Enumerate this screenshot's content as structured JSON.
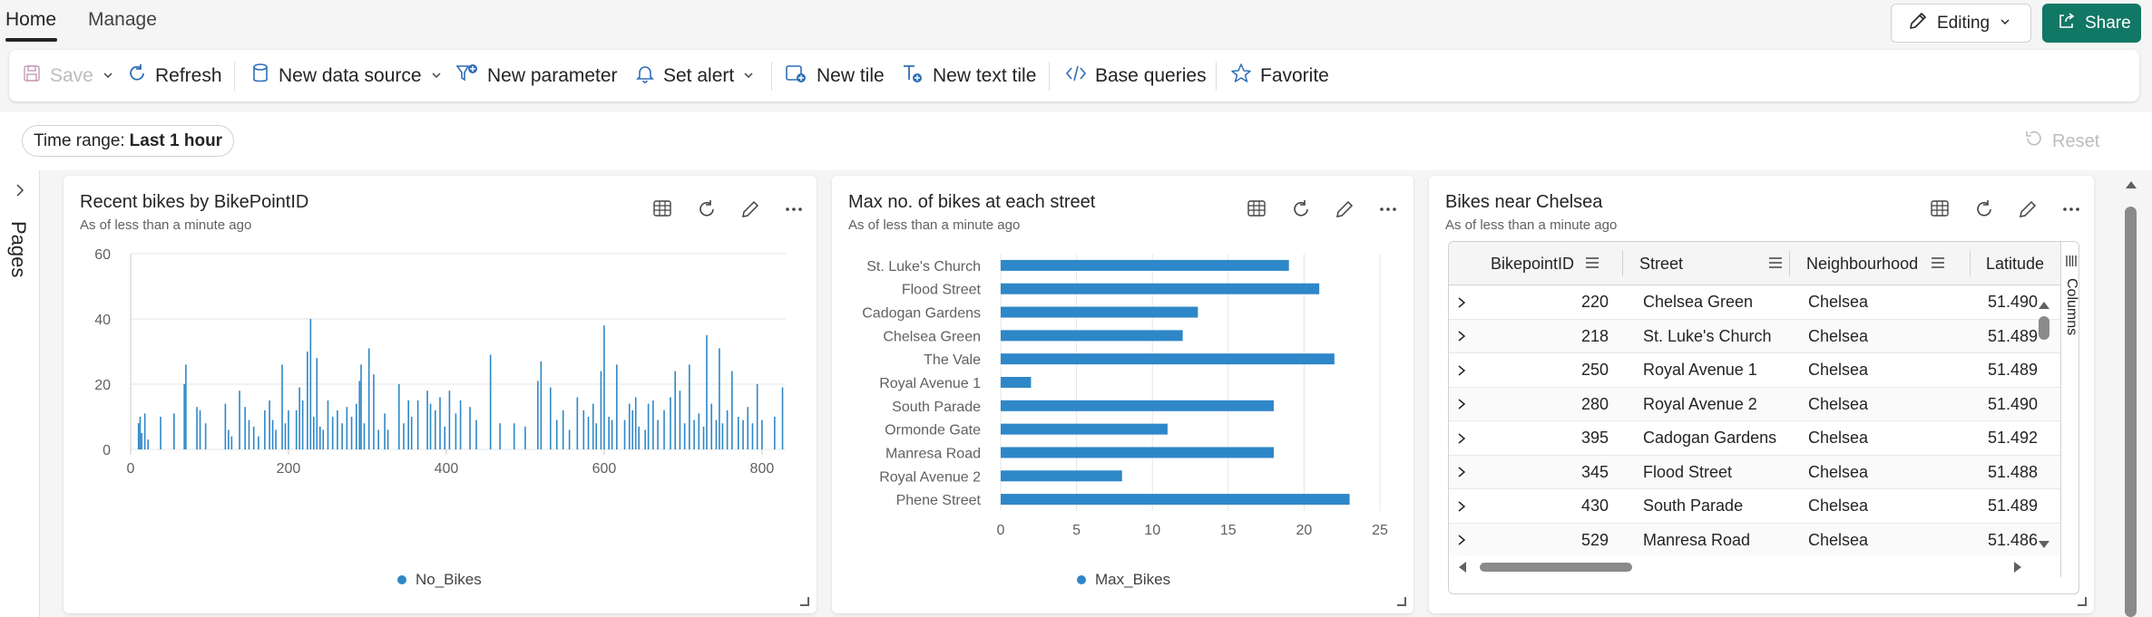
{
  "top_tabs": {
    "home": "Home",
    "manage": "Manage"
  },
  "header_buttons": {
    "editing": "Editing",
    "share": "Share"
  },
  "toolbar": {
    "save": "Save",
    "refresh": "Refresh",
    "new_data_source": "New data source",
    "new_parameter": "New parameter",
    "set_alert": "Set alert",
    "new_tile": "New tile",
    "new_text_tile": "New text tile",
    "base_queries": "Base queries",
    "favorite": "Favorite"
  },
  "filters": {
    "time_range_label": "Time range:",
    "time_range_value": "Last 1 hour",
    "reset": "Reset"
  },
  "pages_label": "Pages",
  "colors": {
    "accent": "#117865",
    "series": "#2e87c8"
  },
  "tiles": [
    {
      "title": "Recent bikes by BikePointID",
      "subtitle": "As of less than a minute ago",
      "legend": "No_Bikes"
    },
    {
      "title": "Max no. of bikes at each street",
      "subtitle": "As of less than a minute ago",
      "legend": "Max_Bikes"
    },
    {
      "title": "Bikes near Chelsea",
      "subtitle": "As of less than a minute ago"
    }
  ],
  "chart_data": [
    {
      "type": "bar",
      "title": "Recent bikes by BikePointID",
      "xlim": [
        0,
        830
      ],
      "ylim": [
        0,
        60
      ],
      "x_ticks": [
        "0",
        "200",
        "400",
        "600",
        "800"
      ],
      "y_ticks": [
        "0",
        "20",
        "40",
        "60"
      ],
      "grid": true,
      "legend_position": "bottom",
      "series": [
        {
          "name": "No_Bikes",
          "points": [
            [
              10,
              8
            ],
            [
              12,
              10
            ],
            [
              14,
              5
            ],
            [
              18,
              11
            ],
            [
              22,
              3
            ],
            [
              38,
              10
            ],
            [
              55,
              11
            ],
            [
              68,
              20
            ],
            [
              70,
              26
            ],
            [
              84,
              13
            ],
            [
              88,
              12
            ],
            [
              95,
              8
            ],
            [
              120,
              14
            ],
            [
              124,
              6
            ],
            [
              128,
              4
            ],
            [
              138,
              18
            ],
            [
              145,
              13
            ],
            [
              150,
              9
            ],
            [
              156,
              7
            ],
            [
              162,
              4
            ],
            [
              170,
              12
            ],
            [
              176,
              15
            ],
            [
              180,
              9
            ],
            [
              184,
              6
            ],
            [
              192,
              26
            ],
            [
              196,
              8
            ],
            [
              200,
              12
            ],
            [
              210,
              12
            ],
            [
              214,
              19
            ],
            [
              218,
              15
            ],
            [
              224,
              30
            ],
            [
              228,
              40
            ],
            [
              232,
              10
            ],
            [
              236,
              28
            ],
            [
              240,
              7
            ],
            [
              244,
              6
            ],
            [
              250,
              15
            ],
            [
              256,
              10
            ],
            [
              262,
              12
            ],
            [
              268,
              8
            ],
            [
              274,
              13
            ],
            [
              280,
              10
            ],
            [
              286,
              14
            ],
            [
              290,
              21
            ],
            [
              292,
              26
            ],
            [
              296,
              8
            ],
            [
              302,
              31
            ],
            [
              308,
              23
            ],
            [
              314,
              6
            ],
            [
              322,
              11
            ],
            [
              326,
              6
            ],
            [
              340,
              20
            ],
            [
              346,
              8
            ],
            [
              352,
              15
            ],
            [
              356,
              10
            ],
            [
              364,
              15
            ],
            [
              376,
              18
            ],
            [
              380,
              14
            ],
            [
              386,
              12
            ],
            [
              392,
              16
            ],
            [
              398,
              7
            ],
            [
              404,
              18
            ],
            [
              412,
              11
            ],
            [
              418,
              15
            ],
            [
              430,
              13
            ],
            [
              438,
              9
            ],
            [
              456,
              29
            ],
            [
              468,
              8
            ],
            [
              486,
              8
            ],
            [
              500,
              7
            ],
            [
              516,
              21
            ],
            [
              520,
              27
            ],
            [
              532,
              19
            ],
            [
              540,
              9
            ],
            [
              548,
              12
            ],
            [
              556,
              6
            ],
            [
              566,
              16
            ],
            [
              574,
              12
            ],
            [
              580,
              10
            ],
            [
              586,
              14
            ],
            [
              590,
              8
            ],
            [
              596,
              24
            ],
            [
              600,
              38
            ],
            [
              606,
              10
            ],
            [
              610,
              9
            ],
            [
              616,
              26
            ],
            [
              626,
              9
            ],
            [
              632,
              14
            ],
            [
              636,
              12
            ],
            [
              640,
              16
            ],
            [
              644,
              7
            ],
            [
              652,
              6
            ],
            [
              656,
              14
            ],
            [
              662,
              15
            ],
            [
              668,
              9
            ],
            [
              676,
              12
            ],
            [
              684,
              16
            ],
            [
              690,
              24
            ],
            [
              696,
              18
            ],
            [
              702,
              8
            ],
            [
              708,
              26
            ],
            [
              714,
              9
            ],
            [
              720,
              11
            ],
            [
              726,
              7
            ],
            [
              730,
              35
            ],
            [
              736,
              14
            ],
            [
              742,
              9
            ],
            [
              746,
              31
            ],
            [
              750,
              8
            ],
            [
              756,
              12
            ],
            [
              762,
              24
            ],
            [
              770,
              10
            ],
            [
              776,
              9
            ],
            [
              782,
              13
            ],
            [
              788,
              8
            ],
            [
              794,
              20
            ],
            [
              800,
              9
            ],
            [
              816,
              10
            ],
            [
              826,
              19
            ]
          ]
        }
      ]
    },
    {
      "type": "bar",
      "orientation": "horizontal",
      "title": "Max no. of bikes at each street",
      "categories": [
        "St. Luke's Church",
        "Flood Street",
        "Cadogan Gardens",
        "Chelsea Green",
        "The Vale",
        "Royal Avenue 1",
        "South Parade",
        "Ormonde Gate",
        "Manresa Road",
        "Royal Avenue 2",
        "Phene Street"
      ],
      "values": [
        19,
        21,
        13,
        12,
        22,
        2,
        18,
        11,
        18,
        8,
        23
      ],
      "xlim": [
        0,
        25
      ],
      "x_ticks": [
        "0",
        "5",
        "10",
        "15",
        "20",
        "25"
      ],
      "grid": true,
      "legend_position": "bottom",
      "series": [
        {
          "name": "Max_Bikes"
        }
      ]
    }
  ],
  "table": {
    "columns": [
      "BikepointID",
      "Street",
      "Neighbourhood",
      "Latitude"
    ],
    "columns_panel": "Columns",
    "rows": [
      {
        "id": "220",
        "street": "Chelsea Green",
        "neighbourhood": "Chelsea",
        "lat": "51.490"
      },
      {
        "id": "218",
        "street": "St. Luke's Church",
        "neighbourhood": "Chelsea",
        "lat": "51.489"
      },
      {
        "id": "250",
        "street": "Royal Avenue 1",
        "neighbourhood": "Chelsea",
        "lat": "51.489"
      },
      {
        "id": "280",
        "street": "Royal Avenue 2",
        "neighbourhood": "Chelsea",
        "lat": "51.490"
      },
      {
        "id": "395",
        "street": "Cadogan Gardens",
        "neighbourhood": "Chelsea",
        "lat": "51.492"
      },
      {
        "id": "345",
        "street": "Flood Street",
        "neighbourhood": "Chelsea",
        "lat": "51.488"
      },
      {
        "id": "430",
        "street": "South Parade",
        "neighbourhood": "Chelsea",
        "lat": "51.489"
      },
      {
        "id": "529",
        "street": "Manresa Road",
        "neighbourhood": "Chelsea",
        "lat": "51.486"
      }
    ]
  }
}
